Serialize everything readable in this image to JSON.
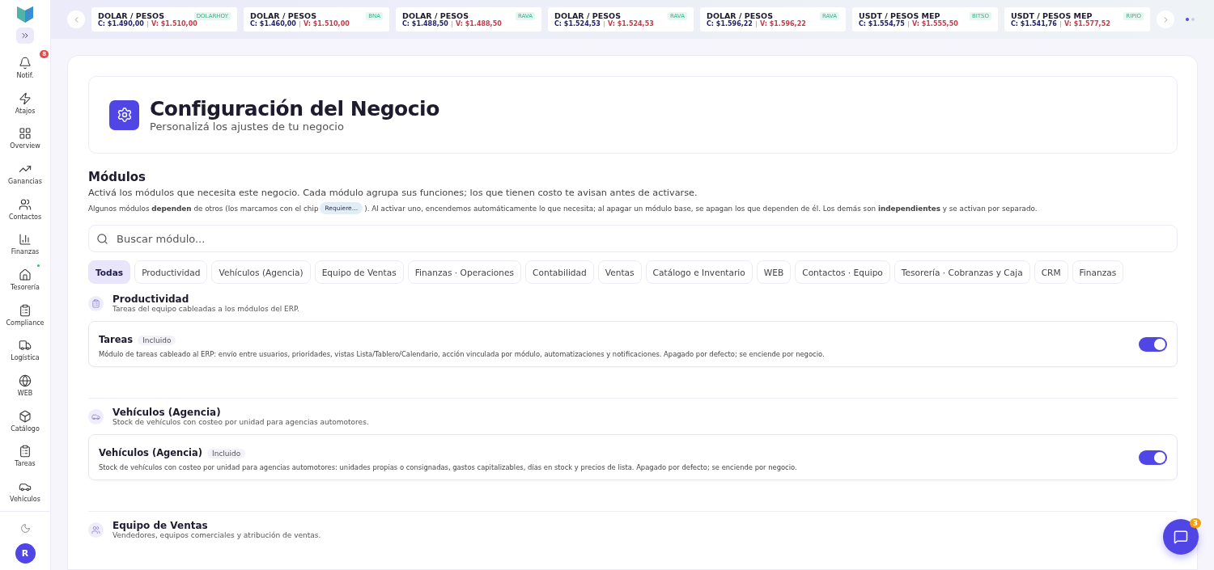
{
  "sidebar": {
    "items": [
      {
        "label": "Notif.",
        "badge": "8",
        "dot": false
      },
      {
        "label": "Atajos",
        "dot": false
      },
      {
        "label": "Overview",
        "dot": false
      },
      {
        "label": "Ganancias",
        "dot": false
      },
      {
        "label": "Contactos",
        "dot": false
      },
      {
        "label": "Finanzas",
        "dot": false
      },
      {
        "label": "Tesorería",
        "dot": true
      },
      {
        "label": "Compliance",
        "dot": false
      },
      {
        "label": "Logística",
        "dot": false
      },
      {
        "label": "WEB",
        "dot": false
      },
      {
        "label": "Catálogo",
        "dot": false
      },
      {
        "label": "Tareas",
        "dot": false
      },
      {
        "label": "Vehículos",
        "dot": false
      }
    ],
    "avatar": "R"
  },
  "ticker": {
    "cards": [
      {
        "title": "DOLAR / PESOS",
        "source": "DOLARHOY",
        "buy": "C: $1.490,00",
        "sell": "V: $1.510,00"
      },
      {
        "title": "DOLAR / PESOS",
        "source": "BNA",
        "buy": "C: $1.460,00",
        "sell": "V: $1.510,00"
      },
      {
        "title": "DOLAR / PESOS",
        "source": "RAVA",
        "buy": "C: $1.488,50",
        "sell": "V: $1.488,50"
      },
      {
        "title": "DOLAR / PESOS",
        "source": "RAVA",
        "buy": "C: $1.524,53",
        "sell": "V: $1.524,53"
      },
      {
        "title": "DOLAR / PESOS",
        "source": "RAVA",
        "buy": "C: $1.596,22",
        "sell": "V: $1.596,22"
      },
      {
        "title": "USDT / PESOS MEP",
        "source": "BITSO",
        "buy": "C: $1.554,75",
        "sell": "V: $1.555,50"
      },
      {
        "title": "USDT / PESOS MEP",
        "source": "RIPIO",
        "buy": "C: $1.541,76",
        "sell": "V: $1.577,52"
      }
    ],
    "pages": [
      {
        "selected": true
      },
      {
        "selected": false
      }
    ]
  },
  "header": {
    "title": "Configuración del Negocio",
    "subtitle": "Personalizá los ajustes de tu negocio"
  },
  "modules": {
    "title": "Módulos",
    "intro": "Activá los módulos que necesita este negocio. Cada módulo agrupa sus funciones; los que tienen costo te avisan antes de activarse.",
    "note_before": "Algunos módulos **dependen** de otros (los marcamos con el chip",
    "chip": "Requiere…",
    "note_after": "). Al activar uno, encendemos automáticamente lo que necesita; al apagar un módulo base, se apagan los que dependen de él. Los demás son **independientes** y se activan por separado.",
    "search": {
      "placeholder": "Buscar módulo..."
    },
    "tabs": [
      {
        "label": "Todas",
        "selected": true
      },
      {
        "label": "Productividad",
        "selected": false
      },
      {
        "label": "Vehículos (Agencia)",
        "selected": false
      },
      {
        "label": "Equipo de Ventas",
        "selected": false
      },
      {
        "label": "Finanzas · Operaciones",
        "selected": false
      },
      {
        "label": "Contabilidad",
        "selected": false
      },
      {
        "label": "Ventas",
        "selected": false
      },
      {
        "label": "Catálogo e Inventario",
        "selected": false
      },
      {
        "label": "WEB",
        "selected": false
      },
      {
        "label": "Contactos · Equipo",
        "selected": false
      },
      {
        "label": "Tesorería · Cobranzas y Caja",
        "selected": false
      },
      {
        "label": "CRM",
        "selected": false
      },
      {
        "label": "Finanzas",
        "selected": false
      }
    ],
    "sections": [
      {
        "title": "Productividad",
        "subtitle": "Tareas del equipo cableadas a los módulos del ERP.",
        "items": [
          {
            "name": "Tareas",
            "badge": "Incluido",
            "description": "Módulo de tareas cableado al ERP: envío entre usuarios, prioridades, vistas Lista/Tablero/Calendario, acción vinculada por módulo, automatizaciones y notificaciones. Apagado por defecto; se enciende por negocio.",
            "on": true
          }
        ]
      },
      {
        "title": "Vehículos (Agencia)",
        "subtitle": "Stock de vehículos con costeo por unidad para agencias automotores.",
        "items": [
          {
            "name": "Vehículos (Agencia)",
            "badge": "Incluido",
            "description": "Stock de vehículos con costeo por unidad para agencias automotores: unidades propias o consignadas, gastos capitalizables, días en stock y precios de lista. Apagado por defecto; se enciende por negocio.",
            "on": true
          }
        ]
      },
      {
        "title": "Equipo de Ventas",
        "subtitle": "Vendedores, equipos comerciales y atribución de ventas."
      }
    ]
  },
  "chat": {
    "badge": "3"
  }
}
